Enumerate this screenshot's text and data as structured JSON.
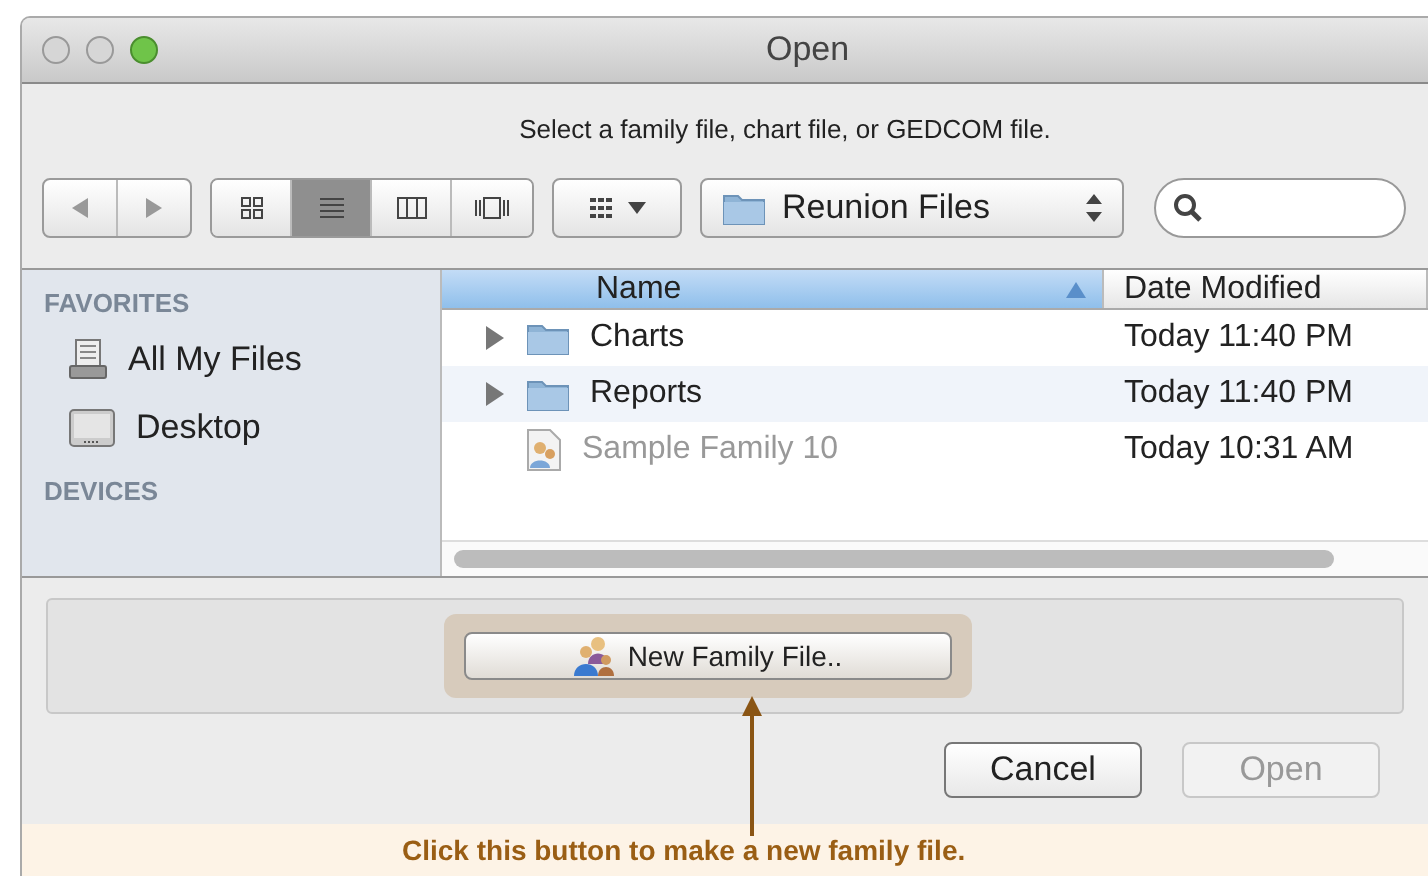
{
  "window": {
    "title": "Open"
  },
  "message": "Select a family file, chart file, or GEDCOM file.",
  "view_modes": [
    {
      "kind": "icons",
      "selected": false
    },
    {
      "kind": "list",
      "selected": true
    },
    {
      "kind": "columns",
      "selected": false
    },
    {
      "kind": "coverflow",
      "selected": false
    }
  ],
  "location": {
    "label": "Reunion Files"
  },
  "sidebar": {
    "sections": [
      {
        "heading": "FAVORITES",
        "items": [
          {
            "kind": "files",
            "label": "All My Files"
          },
          {
            "kind": "desktop",
            "label": "Desktop"
          }
        ]
      },
      {
        "heading": "DEVICES"
      }
    ]
  },
  "table": {
    "columns": [
      {
        "label": "Name",
        "sorted": true
      },
      {
        "label": "Date Modified",
        "sorted": false
      }
    ],
    "rows": [
      {
        "kind": "folder",
        "name": "Charts",
        "date": "Today 11:40 PM",
        "expanded": false,
        "disabled": false
      },
      {
        "kind": "folder",
        "name": "Reports",
        "date": "Today 11:40 PM",
        "expanded": false,
        "disabled": false
      },
      {
        "kind": "file",
        "name": "Sample Family 10",
        "date": "Today 10:31 AM",
        "disabled": true
      }
    ]
  },
  "accessory": {
    "button": "New Family File.."
  },
  "buttons": [
    {
      "label": "Cancel",
      "disabled": false
    },
    {
      "label": "Open",
      "disabled": true
    }
  ],
  "caption": "Click this button to make a new family file."
}
